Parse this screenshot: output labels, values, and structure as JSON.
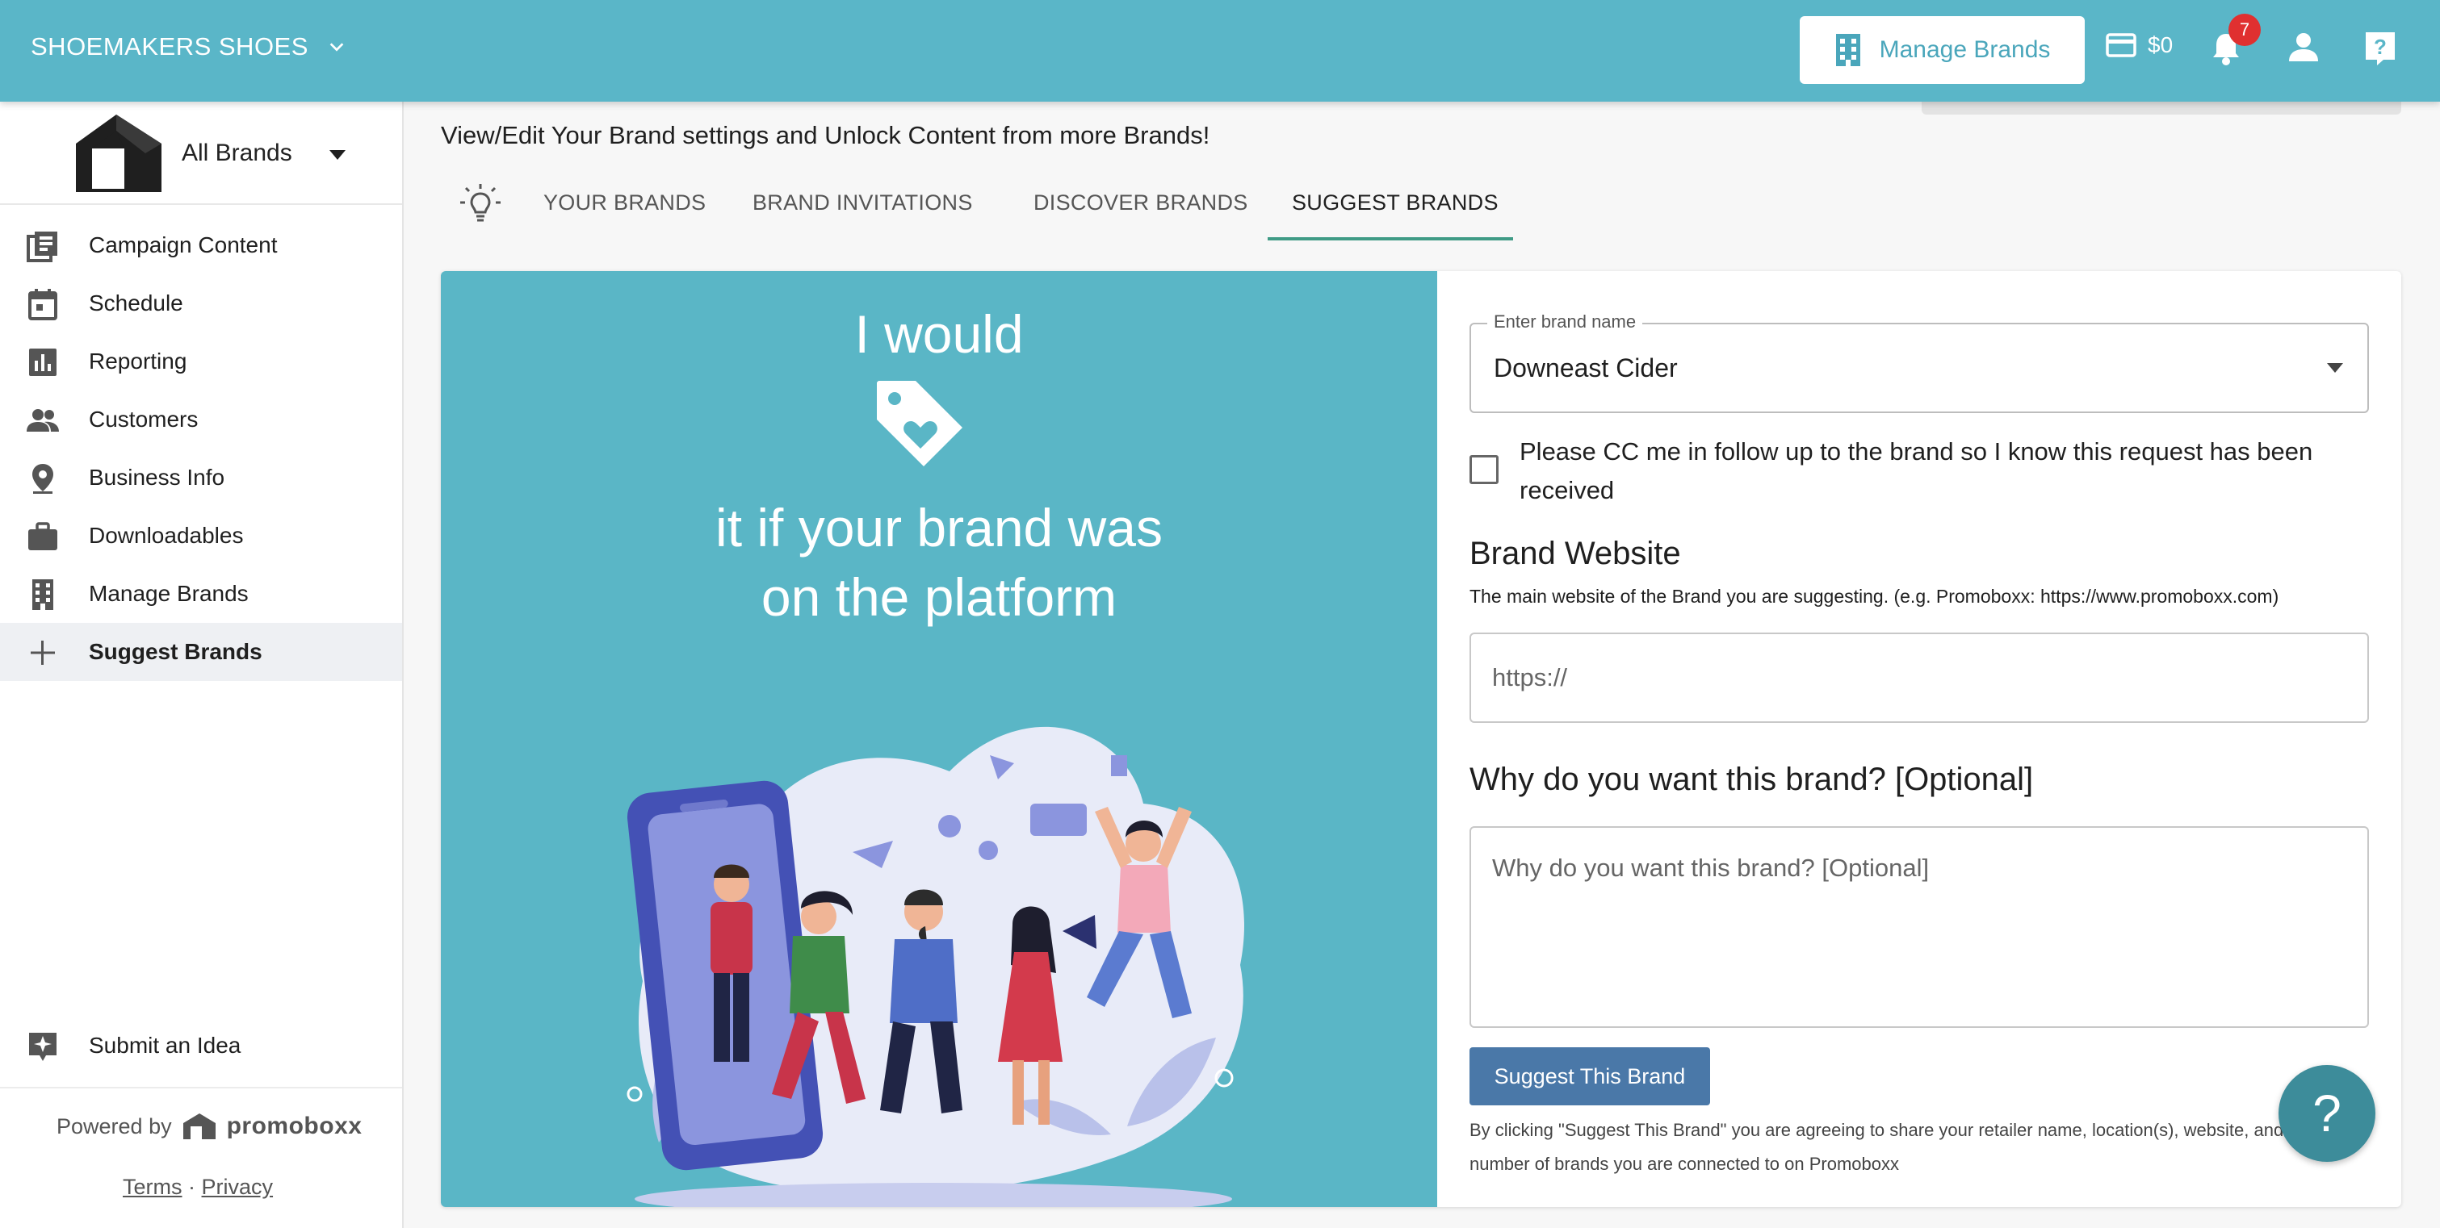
{
  "topbar": {
    "store_name": "SHOEMAKERS SHOES",
    "manage_brands_label": "Manage Brands",
    "wallet_amount": "$0",
    "notification_count": "7",
    "accent_color": "#5ab6c8"
  },
  "sidebar": {
    "brand_switch_label": "All Brands",
    "items": [
      {
        "label": "Campaign Content",
        "icon": "campaign-content-icon"
      },
      {
        "label": "Schedule",
        "icon": "calendar-icon"
      },
      {
        "label": "Reporting",
        "icon": "bar-chart-icon"
      },
      {
        "label": "Customers",
        "icon": "people-icon"
      },
      {
        "label": "Business Info",
        "icon": "location-pin-icon"
      },
      {
        "label": "Downloadables",
        "icon": "briefcase-icon"
      },
      {
        "label": "Manage Brands",
        "icon": "building-icon"
      },
      {
        "label": "Suggest Brands",
        "icon": "plus-icon",
        "active": true
      }
    ],
    "submit_idea_label": "Submit an Idea",
    "powered_by": "Powered by",
    "powered_brand": "promoboxx",
    "terms": "Terms",
    "separator": "·",
    "privacy": "Privacy"
  },
  "main": {
    "subtitle": "View/Edit Your Brand settings and Unlock Content from more Brands!",
    "tabs": [
      {
        "label": "YOUR BRANDS"
      },
      {
        "label": "BRAND INVITATIONS"
      },
      {
        "label": "DISCOVER BRANDS"
      },
      {
        "label": "SUGGEST BRANDS",
        "active": true
      }
    ]
  },
  "promo": {
    "line1": "I would",
    "line2": "it if your brand was",
    "line3": "on the platform"
  },
  "form": {
    "brand_name_legend": "Enter brand name",
    "brand_name_value": "Downeast Cider",
    "cc_label": "Please CC me in follow up to the brand so I know this request has been received",
    "website_title": "Brand Website",
    "website_help": "The main website of the Brand you are suggesting. (e.g. Promoboxx: https://www.promoboxx.com)",
    "website_placeholder": "https://",
    "why_title": "Why do you want this brand? [Optional]",
    "why_placeholder": "Why do you want this brand? [Optional]",
    "submit_label": "Suggest This Brand",
    "disclaimer": "By clicking \"Suggest This Brand\" you are agreeing to share your retailer name, location(s), website, and the number of brands you are connected to on Promoboxx"
  },
  "fab_label": "?"
}
